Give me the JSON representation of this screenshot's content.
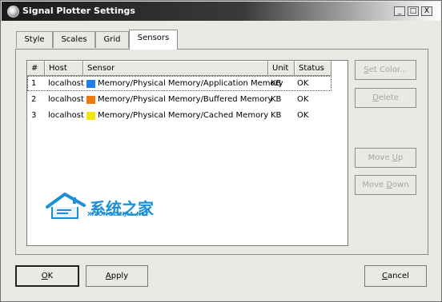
{
  "window": {
    "title": "Signal Plotter Settings",
    "controls": {
      "minimize": "_",
      "maximize": "□",
      "close": "X"
    }
  },
  "tabs": [
    {
      "label": "Style",
      "active": false
    },
    {
      "label": "Scales",
      "active": false
    },
    {
      "label": "Grid",
      "active": false
    },
    {
      "label": "Sensors",
      "active": true
    }
  ],
  "sensors_table": {
    "columns": [
      "#",
      "Host",
      "Sensor",
      "Unit",
      "Status"
    ],
    "rows": [
      {
        "num": "1",
        "host": "localhost",
        "color": "#1e7fe8",
        "sensor": "Memory/Physical Memory/Application Memory",
        "unit": "KB",
        "status": "OK"
      },
      {
        "num": "2",
        "host": "localhost",
        "color": "#f07a10",
        "sensor": "Memory/Physical Memory/Buffered Memory",
        "unit": "KB",
        "status": "OK"
      },
      {
        "num": "3",
        "host": "localhost",
        "color": "#f5e40a",
        "sensor": "Memory/Physical Memory/Cached Memory",
        "unit": "KB",
        "status": "OK"
      }
    ]
  },
  "side_buttons": {
    "set_color": {
      "mn": "S",
      "rest": "et Color..."
    },
    "delete": {
      "mn": "D",
      "rest": "elete"
    },
    "move_up": {
      "pre": "Move ",
      "mn": "U",
      "rest": "p"
    },
    "move_down": {
      "pre": "Move ",
      "mn": "D",
      "rest": "own"
    }
  },
  "watermark": {
    "cn": "系统之家",
    "en": "XITONGZHIJIA.NET"
  },
  "footer": {
    "ok": {
      "mn": "O",
      "rest": "K"
    },
    "apply": {
      "mn": "A",
      "rest": "pply"
    },
    "cancel": {
      "mn": "C",
      "rest": "ancel"
    }
  },
  "colors": {
    "accent_watermark": "#1c8fd8"
  }
}
